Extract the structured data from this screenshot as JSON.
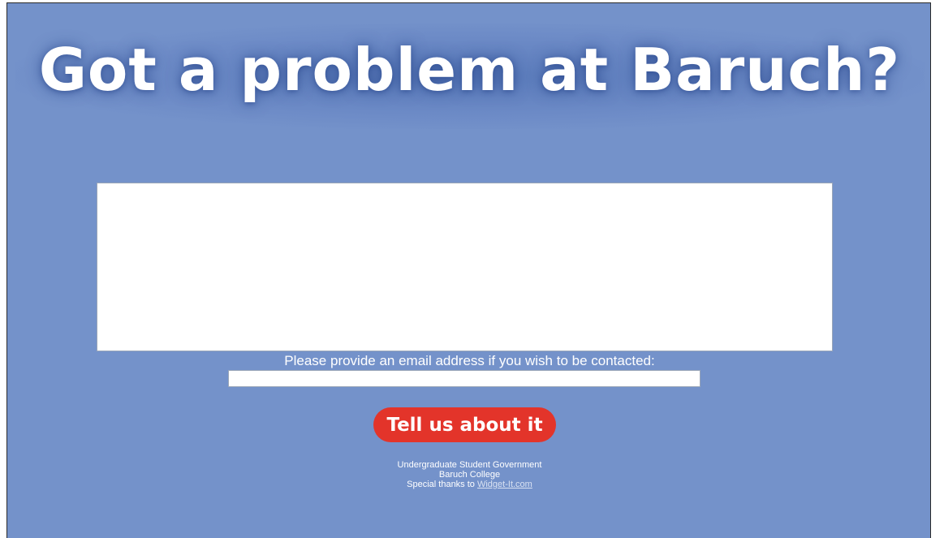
{
  "header": {
    "title": "Got a problem at Baruch?"
  },
  "form": {
    "message_value": "",
    "email_label": "Please provide an email address if you wish to be contacted:",
    "email_value": "",
    "submit_label": "Tell us about it"
  },
  "footer": {
    "line1": "Undergraduate Student Government",
    "line2": "Baruch College",
    "line3_prefix": "Special thanks to ",
    "link_text": "Widget-It.com"
  },
  "colors": {
    "background": "#7492ca",
    "button": "#e3342a",
    "text": "#ffffff"
  }
}
